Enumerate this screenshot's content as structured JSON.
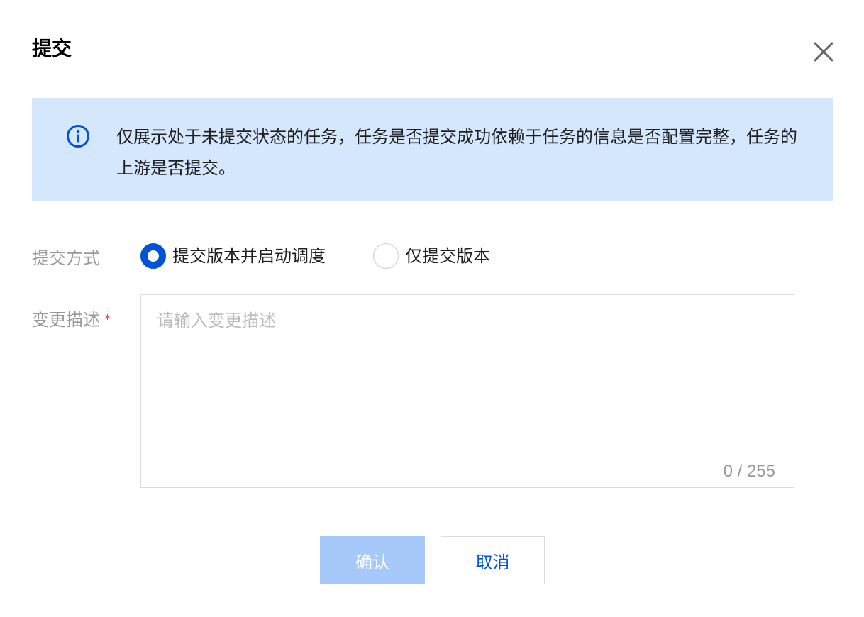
{
  "dialog": {
    "title": "提交",
    "close_icon": "close-icon"
  },
  "notice": {
    "icon": "info-circle-icon",
    "text": "仅展示处于未提交状态的任务，任务是否提交成功依赖于任务的信息是否配置完整，任务的上游是否提交。"
  },
  "form": {
    "method_label": "提交方式",
    "method_options": [
      {
        "label": "提交版本并启动调度",
        "selected": true
      },
      {
        "label": "仅提交版本",
        "selected": false
      }
    ],
    "desc_label": "变更描述",
    "required_mark": "*",
    "desc_placeholder": "请输入变更描述",
    "desc_value": "",
    "counter": "0 / 255"
  },
  "buttons": {
    "confirm": "确认",
    "cancel": "取消"
  },
  "colors": {
    "primary": "#0052d9",
    "notice_bg": "#d5e7fd",
    "confirm_disabled_bg": "#a6c9fa",
    "required": "#e54545"
  }
}
